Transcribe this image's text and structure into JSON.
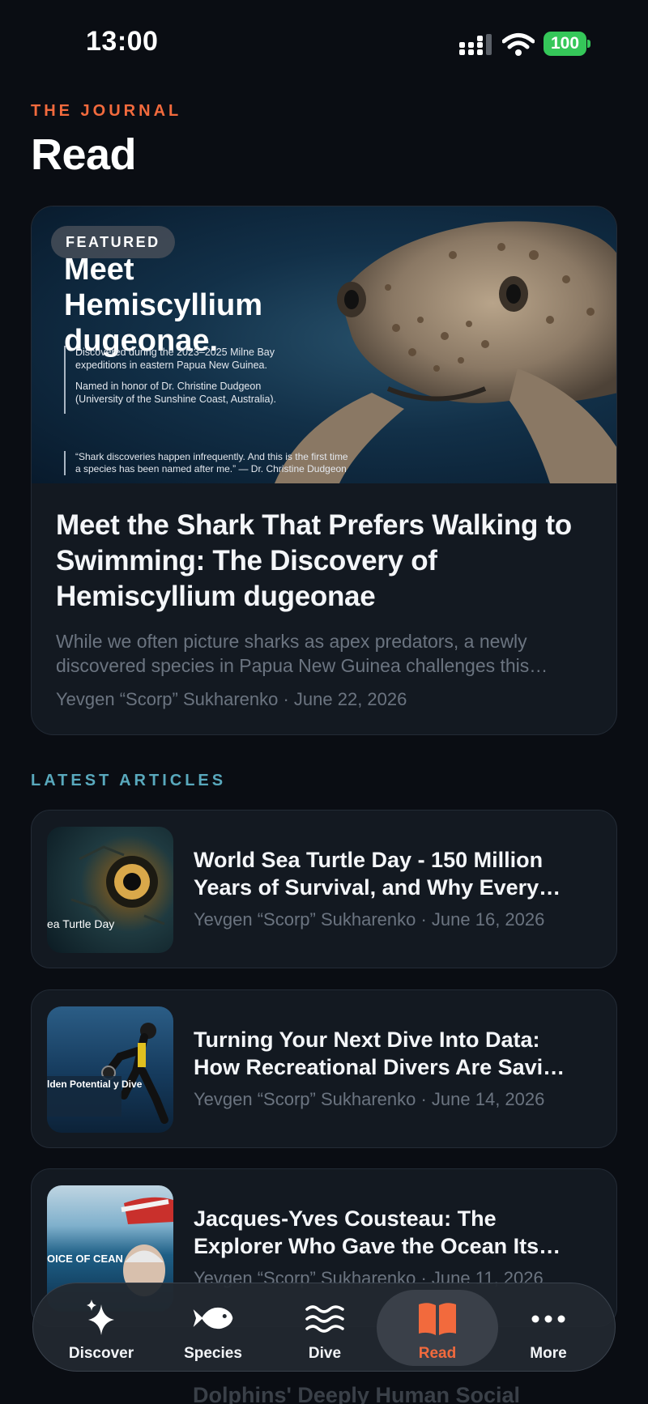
{
  "status_bar": {
    "time": "13:00",
    "battery": "100"
  },
  "header": {
    "eyebrow": "THE JOURNAL",
    "title": "Read"
  },
  "featured": {
    "badge": "FEATURED",
    "image_overlay": {
      "title": "Meet Hemiscyllium dugeonae.",
      "info_1": "Discovered during the 2023–2025 Milne Bay expeditions in eastern Papua New Guinea.",
      "info_2": "Named in honor of Dr. Christine Dudgeon (University of the Sunshine Coast, Australia).",
      "quote": "“Shark discoveries happen infrequently. And this is the first time a species has been named after me.” — Dr. Christine Dudgeon"
    },
    "headline": "Meet the Shark That Prefers Walking to Swimming: The Discovery of Hemiscyllium dugeonae",
    "excerpt": "While we often picture sharks as apex predators, a newly discovered species in Papua New Guinea challenges this…",
    "meta": "Yevgen “Scorp” Sukharenko · June 22, 2026"
  },
  "latest": {
    "label": "LATEST ARTICLES",
    "articles": [
      {
        "title_line1": "World Sea Turtle Day - 150 Million",
        "title_line2": "Years of Survival, and Why Every…",
        "meta": "Yevgen “Scorp” Sukharenko · June 16, 2026",
        "thumb_caption": "ea Turtle Day"
      },
      {
        "title_line1": "Turning Your Next Dive Into Data:",
        "title_line2": "How Recreational Divers Are Savi…",
        "meta": "Yevgen “Scorp” Sukharenko · June 14, 2026",
        "thumb_caption": "lden Potential y Dive"
      },
      {
        "title_line1": "Jacques-Yves Cousteau: The",
        "title_line2": "Explorer Who Gave the Ocean Its…",
        "meta": "Yevgen “Scorp” Sukharenko · June 11, 2026",
        "thumb_caption": "OICE OF CEAN"
      }
    ],
    "next_partial_title": "Dolphins' Deeply Human Social"
  },
  "tab_bar": {
    "tabs": [
      {
        "label": "Discover",
        "icon": "sparkles-icon"
      },
      {
        "label": "Species",
        "icon": "fish-icon"
      },
      {
        "label": "Dive",
        "icon": "waves-icon"
      },
      {
        "label": "Read",
        "icon": "book-icon",
        "active": true
      },
      {
        "label": "More",
        "icon": "ellipsis-icon"
      }
    ]
  },
  "colors": {
    "accent_orange": "#f26a3d",
    "section_teal": "#59a9bd",
    "background": "#0a0d13",
    "card": "#131921",
    "battery_green": "#35c759"
  }
}
